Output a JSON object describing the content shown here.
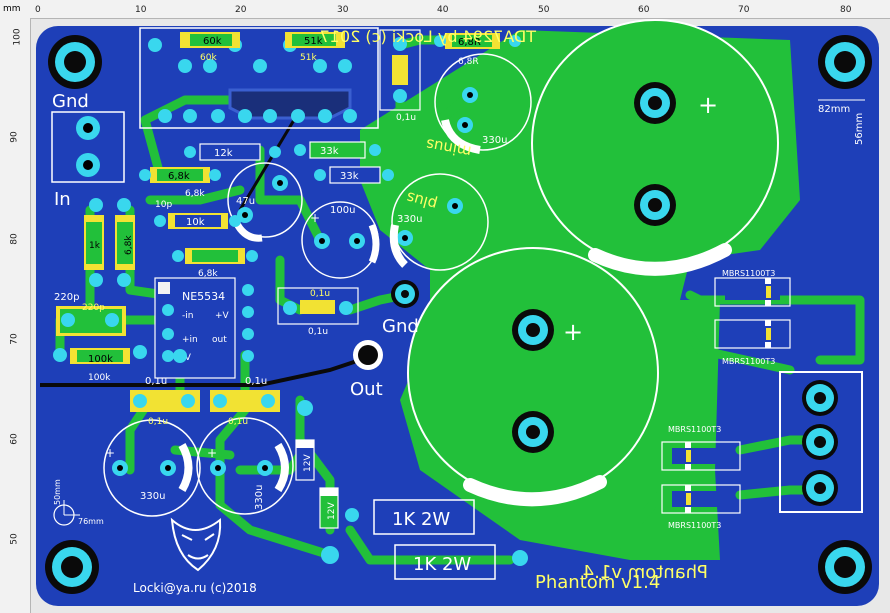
{
  "ruler": {
    "unit": "mm",
    "top_ticks": [
      "0",
      "10",
      "20",
      "30",
      "40",
      "50",
      "60",
      "70",
      "80"
    ],
    "left_ticks": [
      "100",
      "90",
      "80",
      "70",
      "60",
      "50"
    ]
  },
  "title": "TDA7294 by Locki (c) 2017",
  "dimension_82": "82mm",
  "dimension_56": "56mm",
  "dimension_50": "50mm",
  "dimension_76": "76mm",
  "labels": {
    "gnd_top": "Gnd",
    "in": "In",
    "gnd_mid": "Gnd",
    "out": "Out",
    "minus": "minus",
    "plus": "plus",
    "r_1k2w_a": "1K 2W",
    "r_1k2w_b": "1K 2W",
    "phantom": "Phantom v1.4",
    "phantom_mirror": "Phantom v1.4",
    "author": "Locki@ya.ru (c)2018",
    "ic": "NE5534",
    "ic_in_minus": "-in",
    "ic_in_plus": "+in",
    "ic_v_minus": "-V",
    "ic_v_plus": "+V",
    "ic_out": "out"
  },
  "components": {
    "r60k": "60k",
    "r60k_silk": "60k",
    "r51k": "51k",
    "r51k_silk": "51k",
    "c01_top": "0,1u",
    "r6_8_top": "6,8R",
    "r6_8_silk": "6,8R",
    "r12k": "12k",
    "r33k_a": "33k",
    "r6_8k_a": "6,8k",
    "r6_8k_a_silk": "6,8k",
    "r33k_b": "33k",
    "c47u": "47u",
    "c100u": "100u",
    "c330u_a": "330u",
    "c330u_b": "330u",
    "c330u_c": "330u",
    "c330u_d": "330u",
    "c10p": "10p",
    "r10k": "10k",
    "r6_8k_b": "6,8k",
    "r1k": "1k",
    "r6_8k_v": "6,8k",
    "c01_mid": "0,1u",
    "c01_mid_silk": "0,1u",
    "c220p": "220p",
    "c220p_silk": "220p",
    "r100k": "100k",
    "r100k_silk": "100k",
    "c01_a": "0,1u",
    "c01_b": "0,1u",
    "c01_a_silk": "0,1u",
    "c01_b_silk": "0,1u",
    "z12v_a": "12V",
    "z12v_b": "12V",
    "diode_a": "MBRS1100T3",
    "diode_b": "MBRS1100T3",
    "diode_c": "MBRS1100T3",
    "diode_d": "MBRS1100T3"
  },
  "colors": {
    "board": "#1e3fb8",
    "copper": "#22c03a",
    "silk": "#ffffff",
    "pad": "#39d7ee",
    "drill": "#0a0a0a",
    "comp": "#f2e233"
  }
}
